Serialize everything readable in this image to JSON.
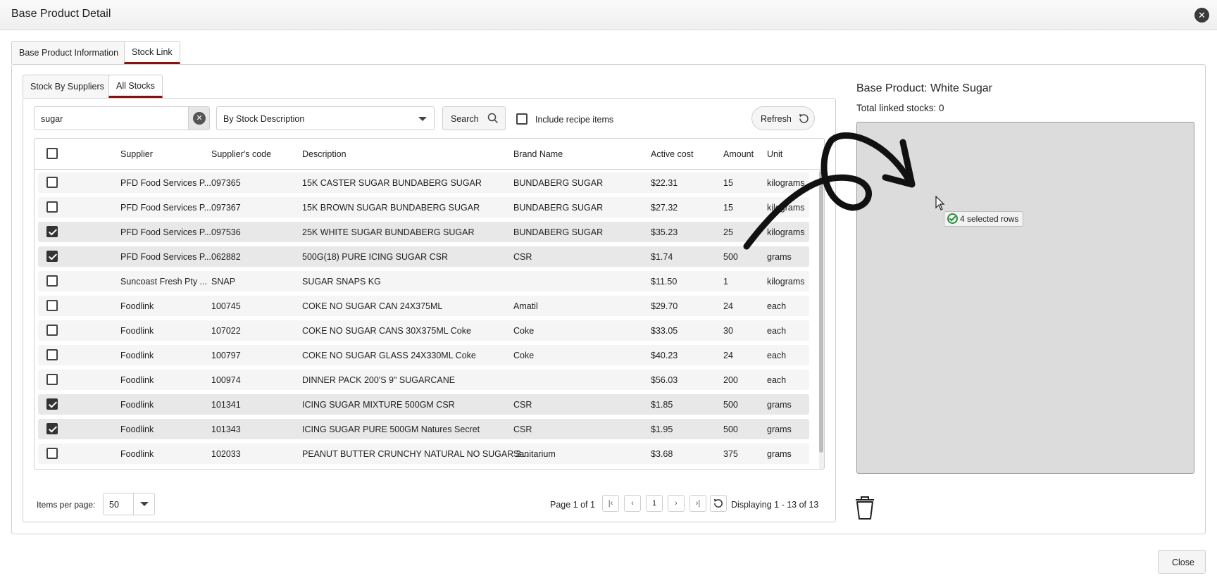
{
  "window": {
    "title": "Base Product Detail"
  },
  "tabs": [
    {
      "label": "Base Product Information",
      "active": false
    },
    {
      "label": "Stock Link",
      "active": true
    }
  ],
  "subtabs": [
    {
      "label": "Stock By Suppliers",
      "active": false
    },
    {
      "label": "All Stocks",
      "active": true
    }
  ],
  "toolbar": {
    "search_value": "sugar",
    "search_by": "By Stock Description",
    "search_label": "Search",
    "include_recipe_label": "Include recipe items",
    "include_recipe_checked": false,
    "refresh_label": "Refresh"
  },
  "grid": {
    "columns": [
      "Supplier",
      "Supplier's code",
      "Description",
      "Brand Name",
      "Active cost",
      "Amount",
      "Unit"
    ],
    "rows": [
      {
        "checked": false,
        "supplier": "PFD Food Services P...",
        "code": "097365",
        "description": "15K CASTER SUGAR BUNDABERG SUGAR",
        "brand": "BUNDABERG SUGAR",
        "cost": "$22.31",
        "amount": "15",
        "unit": "kilograms"
      },
      {
        "checked": false,
        "supplier": "PFD Food Services P...",
        "code": "097367",
        "description": "15K BROWN SUGAR BUNDABERG SUGAR",
        "brand": "BUNDABERG SUGAR",
        "cost": "$27.32",
        "amount": "15",
        "unit": "kilograms"
      },
      {
        "checked": true,
        "supplier": "PFD Food Services P...",
        "code": "097536",
        "description": "25K WHITE SUGAR BUNDABERG SUGAR",
        "brand": "BUNDABERG SUGAR",
        "cost": "$35.23",
        "amount": "25",
        "unit": "kilograms"
      },
      {
        "checked": true,
        "supplier": "PFD Food Services P...",
        "code": "062882",
        "description": "500G(18) PURE ICING SUGAR CSR",
        "brand": "CSR",
        "cost": "$1.74",
        "amount": "500",
        "unit": "grams"
      },
      {
        "checked": false,
        "supplier": "Suncoast Fresh Pty ...",
        "code": "SNAP",
        "description": "SUGAR SNAPS KG",
        "brand": "",
        "cost": "$11.50",
        "amount": "1",
        "unit": "kilograms"
      },
      {
        "checked": false,
        "supplier": "Foodlink",
        "code": "100745",
        "description": "COKE NO SUGAR CAN 24X375ML",
        "brand": "Amatil",
        "cost": "$29.70",
        "amount": "24",
        "unit": "each"
      },
      {
        "checked": false,
        "supplier": "Foodlink",
        "code": "107022",
        "description": "COKE NO SUGAR CANS 30X375ML Coke",
        "brand": "Coke",
        "cost": "$33.05",
        "amount": "30",
        "unit": "each"
      },
      {
        "checked": false,
        "supplier": "Foodlink",
        "code": "100797",
        "description": "COKE NO SUGAR GLASS 24X330ML Coke",
        "brand": "Coke",
        "cost": "$40.23",
        "amount": "24",
        "unit": "each"
      },
      {
        "checked": false,
        "supplier": "Foodlink",
        "code": "100974",
        "description": "DINNER PACK 200'S 9\" SUGARCANE",
        "brand": "",
        "cost": "$56.03",
        "amount": "200",
        "unit": "each"
      },
      {
        "checked": true,
        "supplier": "Foodlink",
        "code": "101341",
        "description": "ICING SUGAR MIXTURE 500GM CSR",
        "brand": "CSR",
        "cost": "$1.85",
        "amount": "500",
        "unit": "grams"
      },
      {
        "checked": true,
        "supplier": "Foodlink",
        "code": "101343",
        "description": "ICING SUGAR PURE 500GM Natures Secret",
        "brand": "CSR",
        "cost": "$1.95",
        "amount": "500",
        "unit": "grams"
      },
      {
        "checked": false,
        "supplier": "Foodlink",
        "code": "102033",
        "description": "PEANUT BUTTER CRUNCHY NATURAL NO SUGAR 3...",
        "brand": "Sanitarium",
        "cost": "$3.68",
        "amount": "375",
        "unit": "grams"
      }
    ]
  },
  "pager": {
    "items_per_page_label": "Items per page:",
    "items_per_page": "50",
    "page_info": "Page 1 of 1",
    "current_page": "1",
    "display_info": "Displaying 1 - 13 of 13"
  },
  "right_panel": {
    "base_product": "Base Product: White Sugar",
    "total_linked": "Total linked stocks: 0",
    "drag_label": "4 selected rows",
    "trash_icon": "trash-icon"
  },
  "footer": {
    "close_label": "Close"
  },
  "colors": {
    "accent": "#8b1010",
    "drop_zone": "#dcdcdc",
    "check_ok": "#2e8b3e"
  }
}
